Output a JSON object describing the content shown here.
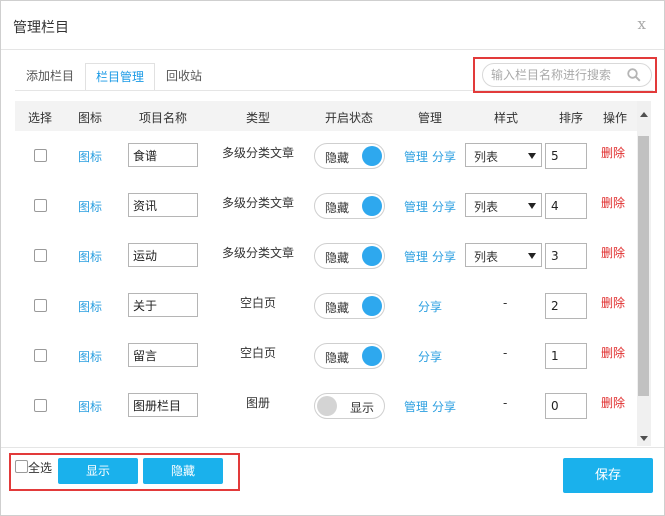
{
  "dialog": {
    "title": "管理栏目",
    "close_label": "x"
  },
  "tabs": [
    {
      "label": "添加栏目",
      "active": false
    },
    {
      "label": "栏目管理",
      "active": true
    },
    {
      "label": "回收站",
      "active": false
    }
  ],
  "search": {
    "placeholder": "输入栏目名称进行搜索",
    "value": ""
  },
  "columns": [
    "选择",
    "图标",
    "项目名称",
    "类型",
    "开启状态",
    "管理",
    "样式",
    "排序",
    "操作"
  ],
  "rows": [
    {
      "checked": false,
      "icon_link": "图标",
      "name": "食谱",
      "type": "多级分类文章",
      "status": "隐藏",
      "status_on": true,
      "manage": "管理",
      "share": "分享",
      "style": "列表",
      "order": "5",
      "delete": "删除"
    },
    {
      "checked": false,
      "icon_link": "图标",
      "name": "资讯",
      "type": "多级分类文章",
      "status": "隐藏",
      "status_on": true,
      "manage": "管理",
      "share": "分享",
      "style": "列表",
      "order": "4",
      "delete": "删除"
    },
    {
      "checked": false,
      "icon_link": "图标",
      "name": "运动",
      "type": "多级分类文章",
      "status": "隐藏",
      "status_on": true,
      "manage": "管理",
      "share": "分享",
      "style": "列表",
      "order": "3",
      "delete": "删除"
    },
    {
      "checked": false,
      "icon_link": "图标",
      "name": "关于",
      "type": "空白页",
      "status": "隐藏",
      "status_on": true,
      "manage": "",
      "share": "分享",
      "style": "-",
      "order": "2",
      "delete": "删除"
    },
    {
      "checked": false,
      "icon_link": "图标",
      "name": "留言",
      "type": "空白页",
      "status": "隐藏",
      "status_on": true,
      "manage": "",
      "share": "分享",
      "style": "-",
      "order": "1",
      "delete": "删除"
    },
    {
      "checked": false,
      "icon_link": "图标",
      "name": "图册栏目",
      "type": "图册",
      "status": "显示",
      "status_on": false,
      "manage": "管理",
      "share": "分享",
      "style": "-",
      "order": "0",
      "delete": "删除"
    }
  ],
  "footer": {
    "select_all_label": "全选",
    "show_button": "显示",
    "hide_button": "隐藏",
    "save_button": "保存"
  },
  "colors": {
    "accent": "#1ab1ec",
    "link": "#2b9fe0",
    "delete": "#e02c2c",
    "highlight_box": "#e23a3a"
  }
}
